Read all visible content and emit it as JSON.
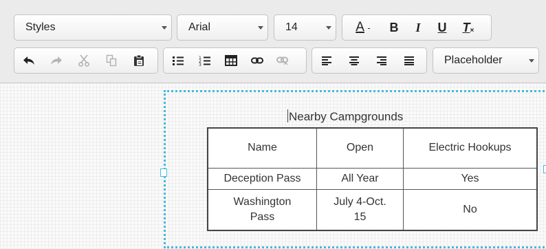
{
  "toolbar": {
    "styles_label": "Styles",
    "font_label": "Arial",
    "size_label": "14",
    "text_color_glyph": "A",
    "bold_glyph": "B",
    "italic_glyph": "I",
    "underline_glyph": "U",
    "clear_format_glyph": "T",
    "placeholder_label": "Placeholder"
  },
  "document": {
    "caption": "Nearby Campgrounds",
    "table": {
      "headers": [
        "Name",
        "Open",
        "Electric Hookups"
      ],
      "rows": [
        [
          "Deception Pass",
          "All Year",
          "Yes"
        ],
        [
          "Washington Pass",
          "July 4-Oct. 15",
          "No"
        ]
      ]
    }
  },
  "colors": {
    "selection_frame": "#45b8de",
    "toolbar_bg": "#ebebeb"
  }
}
